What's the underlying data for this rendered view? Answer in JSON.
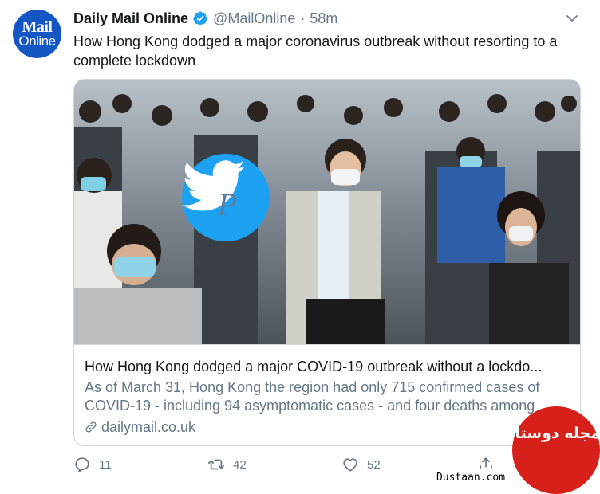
{
  "account": {
    "avatar_line1": "Mail",
    "avatar_line2": "Online",
    "display_name": "Daily Mail Online",
    "handle": "@MailOnline",
    "separator": "·",
    "time": "58m"
  },
  "tweet": {
    "text": "How Hong Kong dodged a major coronavirus outbreak without resorting to a complete lockdown"
  },
  "card": {
    "title": "How Hong Kong dodged a major COVID-19 outbreak without a lockdo...",
    "description": "As of March 31, Hong Kong the region had only 715 confirmed cases of COVID-19 - including 94 asymptomatic cases - and four deaths among",
    "domain": "dailymail.co.uk",
    "image_overlay_letter": "P"
  },
  "actions": {
    "reply_count": "11",
    "retweet_count": "42",
    "like_count": "52"
  },
  "watermark": {
    "site_name": "مجله دوستان",
    "domain": "Dustaan.com"
  },
  "colors": {
    "verified": "#1da1f2",
    "avatar": "#1456c4",
    "muted": "#657786",
    "watermark_red": "#d8201a"
  },
  "icons": {
    "verified": "verified-badge-icon",
    "caret": "chevron-down-icon",
    "link": "link-icon",
    "reply": "reply-icon",
    "retweet": "retweet-icon",
    "like": "heart-icon",
    "share": "share-icon"
  }
}
